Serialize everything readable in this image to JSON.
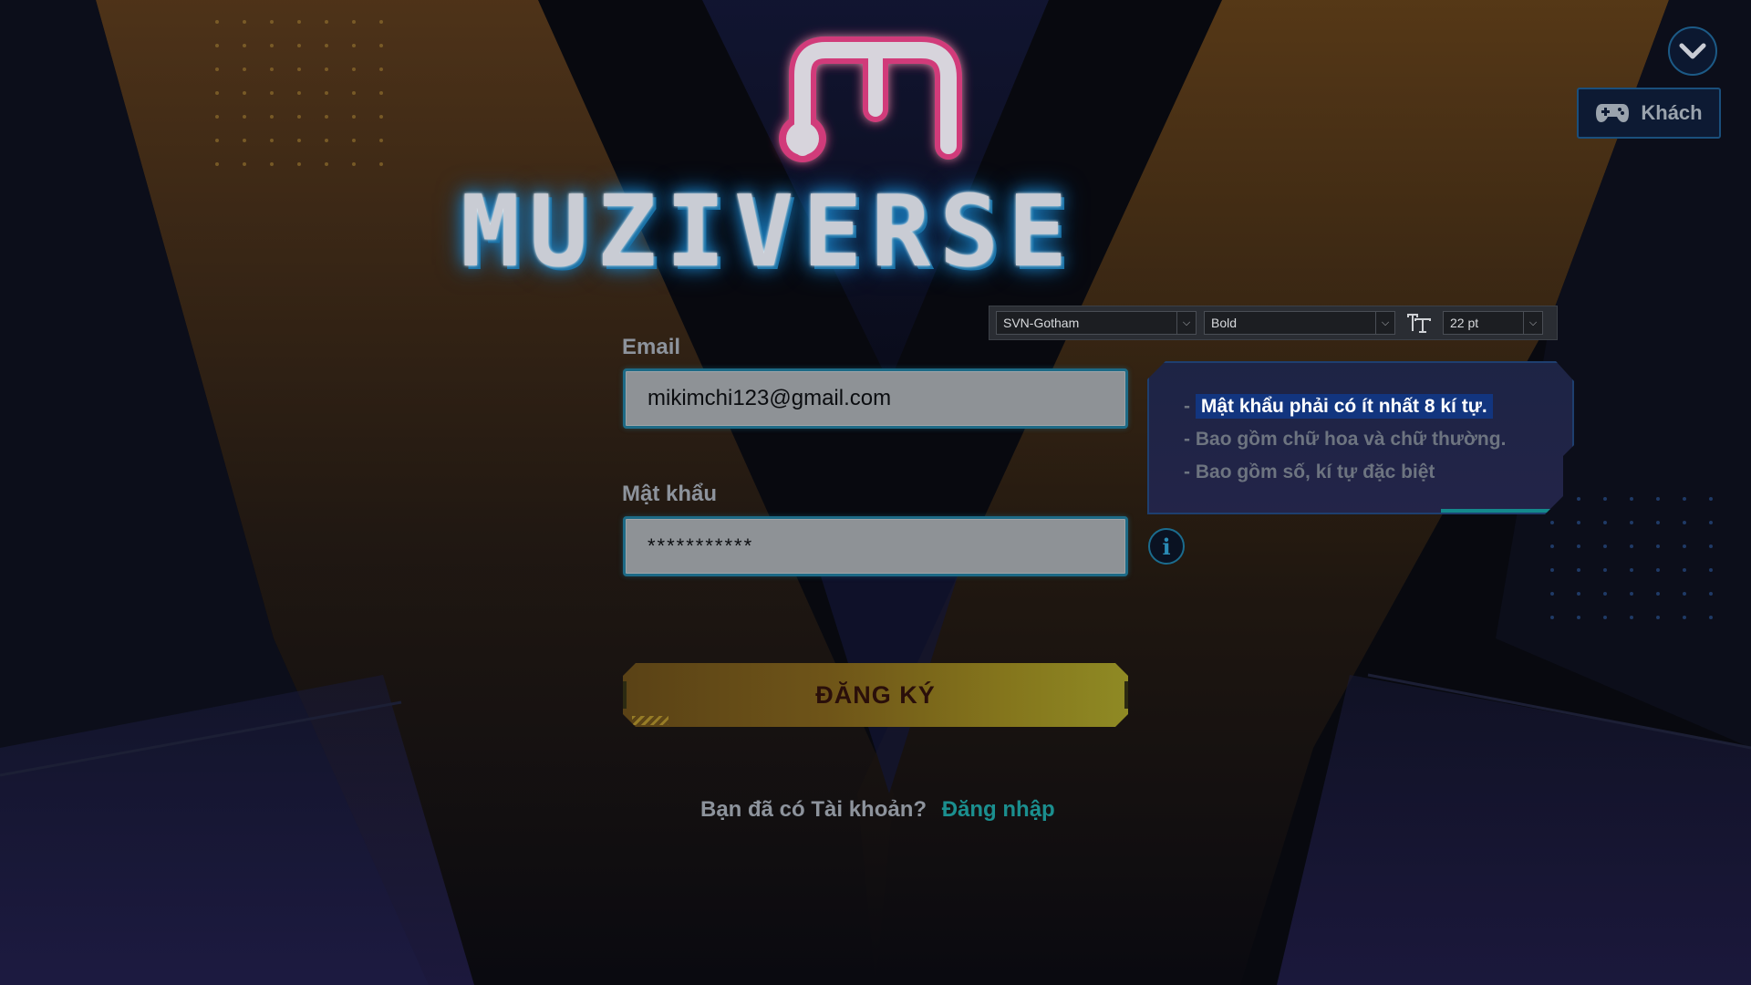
{
  "app": {
    "wordmark": "MUZIVERSE",
    "colors": {
      "accent_teal": "#1b8f8f",
      "logo_glow": "#d13a7a",
      "button_gold": "#84751c",
      "field_border": "#1d6a86"
    }
  },
  "top_right": {
    "collapse_icon": "chevron-down-icon",
    "guest_label": "Khách",
    "guest_icon": "gamepad-icon"
  },
  "form": {
    "email_label": "Email",
    "email_value": "mikimchi123@gmail.com",
    "password_label": "Mật khẩu",
    "password_value": "***********",
    "submit_label": "ĐĂNG KÝ",
    "footer_question": "Bạn đã có Tài khoản?",
    "footer_link": "Đăng nhập"
  },
  "font_toolbar": {
    "font_family": "SVN-Gotham",
    "font_style": "Bold",
    "font_size": "22 pt",
    "size_icon": "text-size-icon"
  },
  "password_hint": {
    "prefix": "-",
    "rules": [
      "Mật khẩu phải có ít nhất 8 kí tự.",
      "Bao gồm chữ hoa và chữ thường.",
      "Bao gồm số, kí tự đặc biệt"
    ],
    "info_icon": "info-icon"
  }
}
